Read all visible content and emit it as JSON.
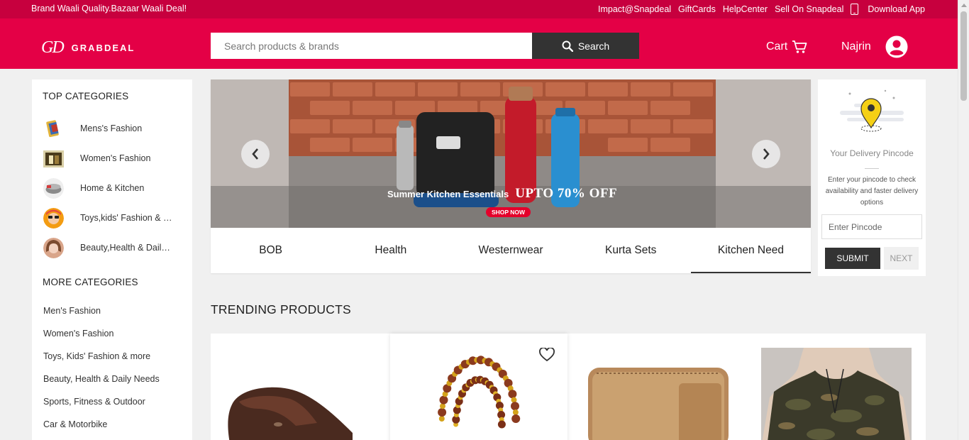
{
  "topbar": {
    "tagline": "Brand Waali Quality.Bazaar Waali Deal!",
    "links": [
      "Impact@Snapdeal",
      "GiftCards",
      "HelpCenter",
      "Sell On Snapdeal"
    ],
    "download_app": "Download App"
  },
  "header": {
    "logo_mark": "GD",
    "logo_text": "GRABDEAL",
    "search": {
      "placeholder": "Search products & brands",
      "button_label": "Search"
    },
    "cart_label": "Cart",
    "user_name": "Najrin"
  },
  "colors": {
    "topbar": "#c7003e",
    "header": "#e40046",
    "dark": "#333333"
  },
  "sidebar": {
    "top_heading": "TOP CATEGORIES",
    "top_categories": [
      {
        "label": "Mens's Fashion",
        "icon": "mens-fashion-thumb"
      },
      {
        "label": "Women's Fashion",
        "icon": "womens-fashion-thumb"
      },
      {
        "label": "Home & Kitchen",
        "icon": "home-kitchen-thumb"
      },
      {
        "label": "Toys,kids' Fashion & m...",
        "icon": "toys-kids-thumb"
      },
      {
        "label": "Beauty,Health & Daily ....",
        "icon": "beauty-health-thumb"
      }
    ],
    "more_heading": "MORE CATEGORIES",
    "more_categories": [
      "Men's Fashion",
      "Women's Fashion",
      "Toys, Kids' Fashion & more",
      "Beauty, Health & Daily Needs",
      "Sports, Fitness & Outdoor",
      "Car & Motorbike"
    ]
  },
  "banner": {
    "headline": "Summer Kitchen Essentials",
    "offer": "UPTO 70% OFF",
    "cta": "SHOP NOW",
    "tabs": [
      "BOB",
      "Health",
      "Westernwear",
      "Kurta Sets",
      "Kitchen Need"
    ],
    "active_tab": "Kitchen Need"
  },
  "pincode": {
    "title": "Your Delivery Pincode",
    "description": "Enter your pincode to check availability and faster delivery options",
    "placeholder": "Enter Pincode",
    "submit_label": "SUBMIT",
    "next_label": "NEXT"
  },
  "trending": {
    "title": "TRENDING PRODUCTS",
    "products": [
      {
        "image": "brown-leather-sandal"
      },
      {
        "image": "rudraksha-bead-mala"
      },
      {
        "image": "tan-leather-wallet"
      },
      {
        "image": "camouflage-tshirt"
      }
    ]
  }
}
